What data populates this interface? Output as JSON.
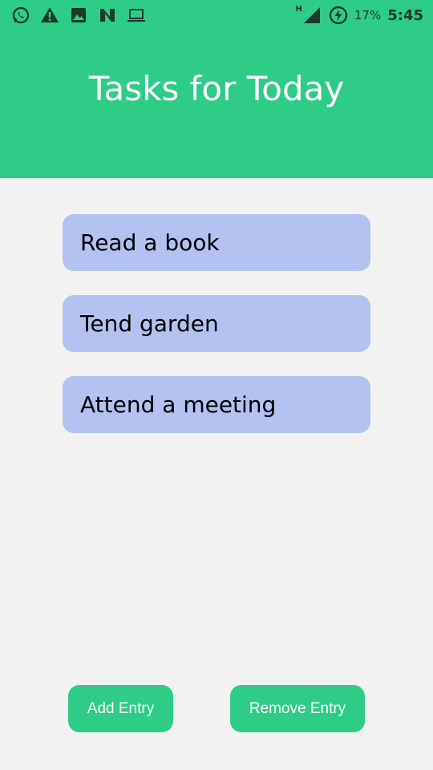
{
  "status_bar": {
    "left_icons": [
      "whatsapp-icon",
      "warning-icon",
      "image-icon",
      "n-app-icon",
      "laptop-icon"
    ],
    "network_type": "H",
    "battery_percent": "17%",
    "time": "5:45"
  },
  "header": {
    "title": "Tasks for Today",
    "color": "#2ecc87"
  },
  "tasks": [
    {
      "label": "Read a book"
    },
    {
      "label": "Tend garden"
    },
    {
      "label": "Attend a meeting"
    }
  ],
  "buttons": {
    "add_label": "Add Entry",
    "remove_label": "Remove Entry"
  },
  "colors": {
    "task_background": "#b3c2f0",
    "page_background": "#f2f2f2"
  }
}
